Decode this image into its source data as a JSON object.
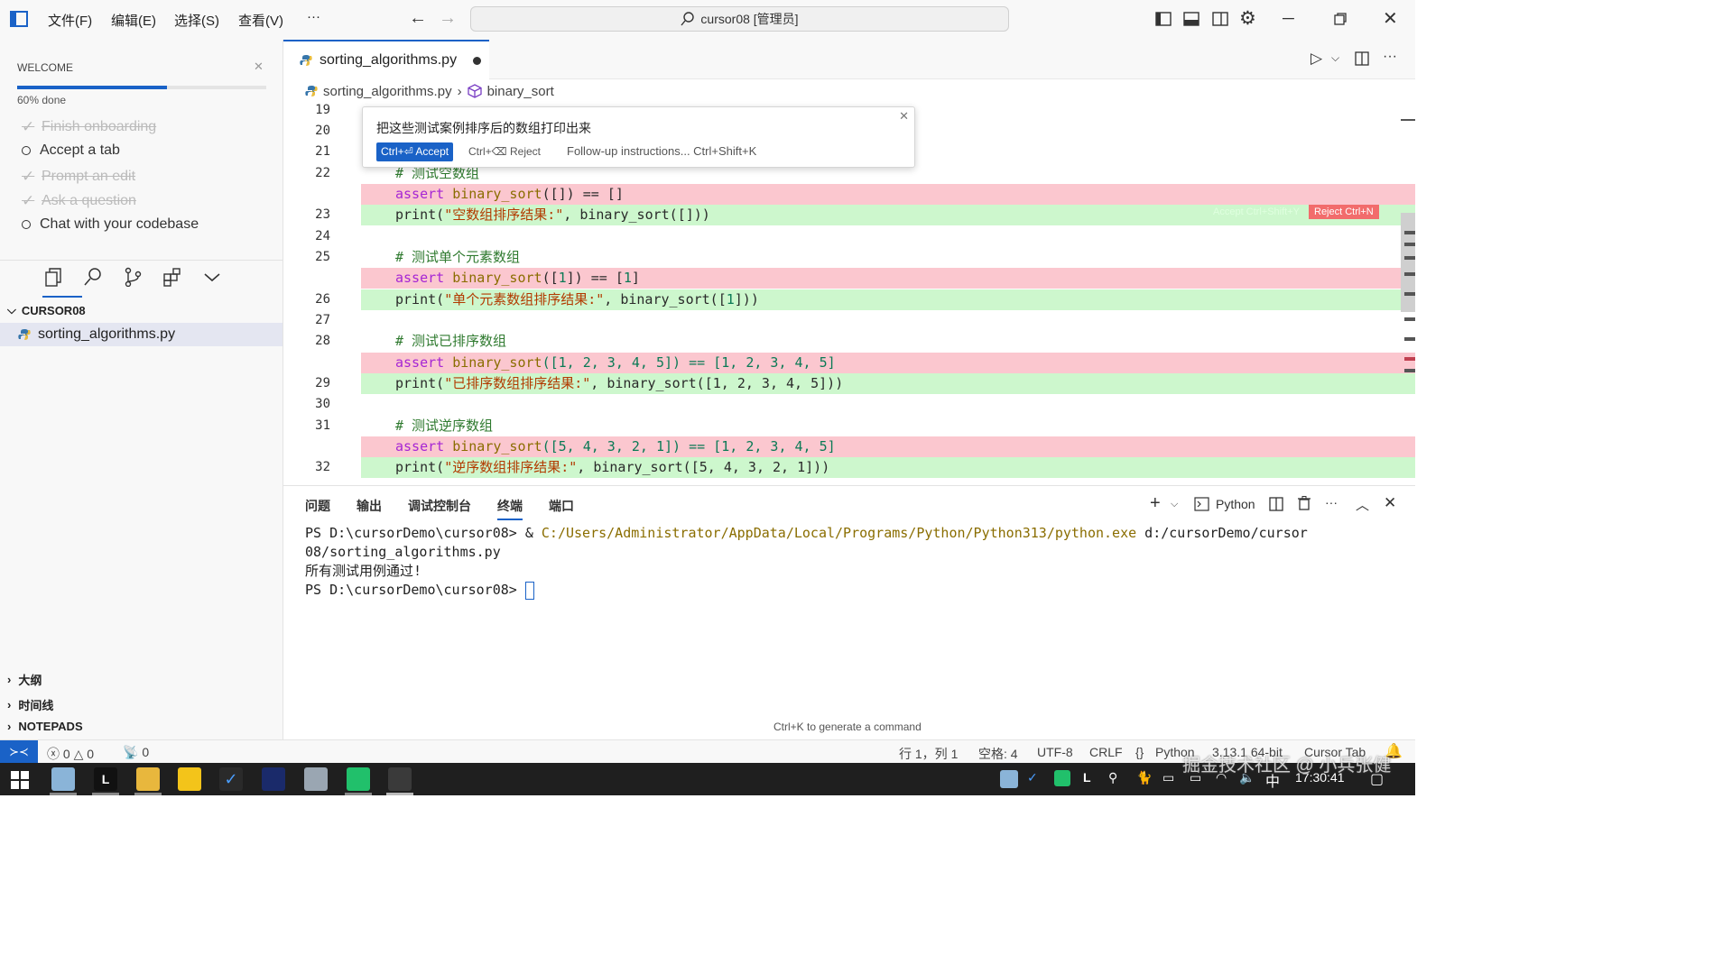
{
  "menu": {
    "items": [
      "文件(F)",
      "编辑(E)",
      "选择(S)",
      "查看(V)",
      "···"
    ]
  },
  "search": {
    "text": "cursor08 [管理员]"
  },
  "welcome": {
    "title": "WELCOME",
    "progress_text": "60% done",
    "progress_fraction": 0.6,
    "items": [
      {
        "label": "Finish onboarding",
        "done": true
      },
      {
        "label": "Accept a tab",
        "done": false
      },
      {
        "label": "Prompt an edit",
        "done": true
      },
      {
        "label": "Ask a question",
        "done": true
      },
      {
        "label": "Chat with your codebase",
        "done": false
      }
    ]
  },
  "explorer": {
    "folder": "CURSOR08",
    "file": "sorting_algorithms.py"
  },
  "sections": {
    "outline": "大纲",
    "timeline": "时间线",
    "notepads": "NOTEPADS"
  },
  "editor": {
    "tab": "sorting_algorithms.py",
    "breadcrumb_file": "sorting_algorithms.py",
    "breadcrumb_symbol": "binary_sort"
  },
  "inline_edit": {
    "prompt": "把这些测试案例排序后的数组打印出来",
    "accept": "Ctrl+⏎ Accept",
    "reject": "Ctrl+⌫ Reject",
    "followup": "Follow-up instructions... Ctrl+Shift+K",
    "hunk_accept": "Accept Ctrl+Shift+Y",
    "hunk_reject": "Reject Ctrl+N"
  },
  "code": {
    "line_numbers": [
      "19",
      "20",
      "21",
      "22",
      "",
      "23",
      "24",
      "25",
      "",
      "26",
      "27",
      "28",
      "",
      "29",
      "30",
      "31",
      "",
      "32"
    ],
    "l22": "# 测试空数组",
    "d1a": "assert",
    "d1b": " binary_sort",
    "d1c": "([]) == []",
    "a1a": "print(",
    "a1b": "\"空数组排序结果:\"",
    "a1c": ", binary_sort([]))",
    "l25": "# 测试单个元素数组",
    "d2a": "assert",
    "d2b": " binary_sort",
    "d2c": "([",
    "d2n": "1",
    "d2d": "]) == [",
    "d2e": "1",
    "d2f": "]",
    "a2a": "print(",
    "a2b": "\"单个元素数组排序结果:\"",
    "a2c": ", binary_sort([",
    "a2n": "1",
    "a2d": "]))",
    "l28": "# 测试已排序数组",
    "d3a": "assert",
    "d3b": " binary_sort",
    "d3c": "([1, 2, 3, 4, 5]) == [1, 2, 3, 4, 5]",
    "a3a": "print(",
    "a3b": "\"已排序数组排序结果:\"",
    "a3c": ", binary_sort([1, 2, 3, 4, 5]))",
    "l31": "# 测试逆序数组",
    "d4a": "assert",
    "d4b": " binary_sort",
    "d4c": "([5, 4, 3, 2, 1]) == [1, 2, 3, 4, 5]",
    "a4a": "print(",
    "a4b": "\"逆序数组排序结果:\"",
    "a4c": ", binary_sort([5, 4, 3, 2, 1]))"
  },
  "panel": {
    "tabs": [
      "问题",
      "输出",
      "调试控制台",
      "终端",
      "端口"
    ],
    "active_tab": "终端",
    "shell": "Python",
    "term1a": "PS D:\\cursorDemo\\cursor08> ",
    "term1b": "& ",
    "term1c": "C:/Users/Administrator/AppData/Local/Programs/Python/Python313/python.exe",
    "term1d": " d:/cursorDemo/cursor",
    "term2": "08/sorting_algorithms.py",
    "term3": "所有测试用例通过!",
    "term4": "PS D:\\cursorDemo\\cursor08> ",
    "hint": "Ctrl+K to generate a command"
  },
  "status": {
    "errors": "0",
    "warnings": "0",
    "ports": "0",
    "position": "行 1，列 1",
    "spaces": "空格: 4",
    "encoding": "UTF-8",
    "eol": "CRLF",
    "language": "Python",
    "version": "3.13.1 64-bit",
    "cursor_tab": "Cursor Tab"
  },
  "taskbar": {
    "ime": "中",
    "time": "17:30:41"
  },
  "watermark": "掘金技术社区 @ 小兵张健"
}
